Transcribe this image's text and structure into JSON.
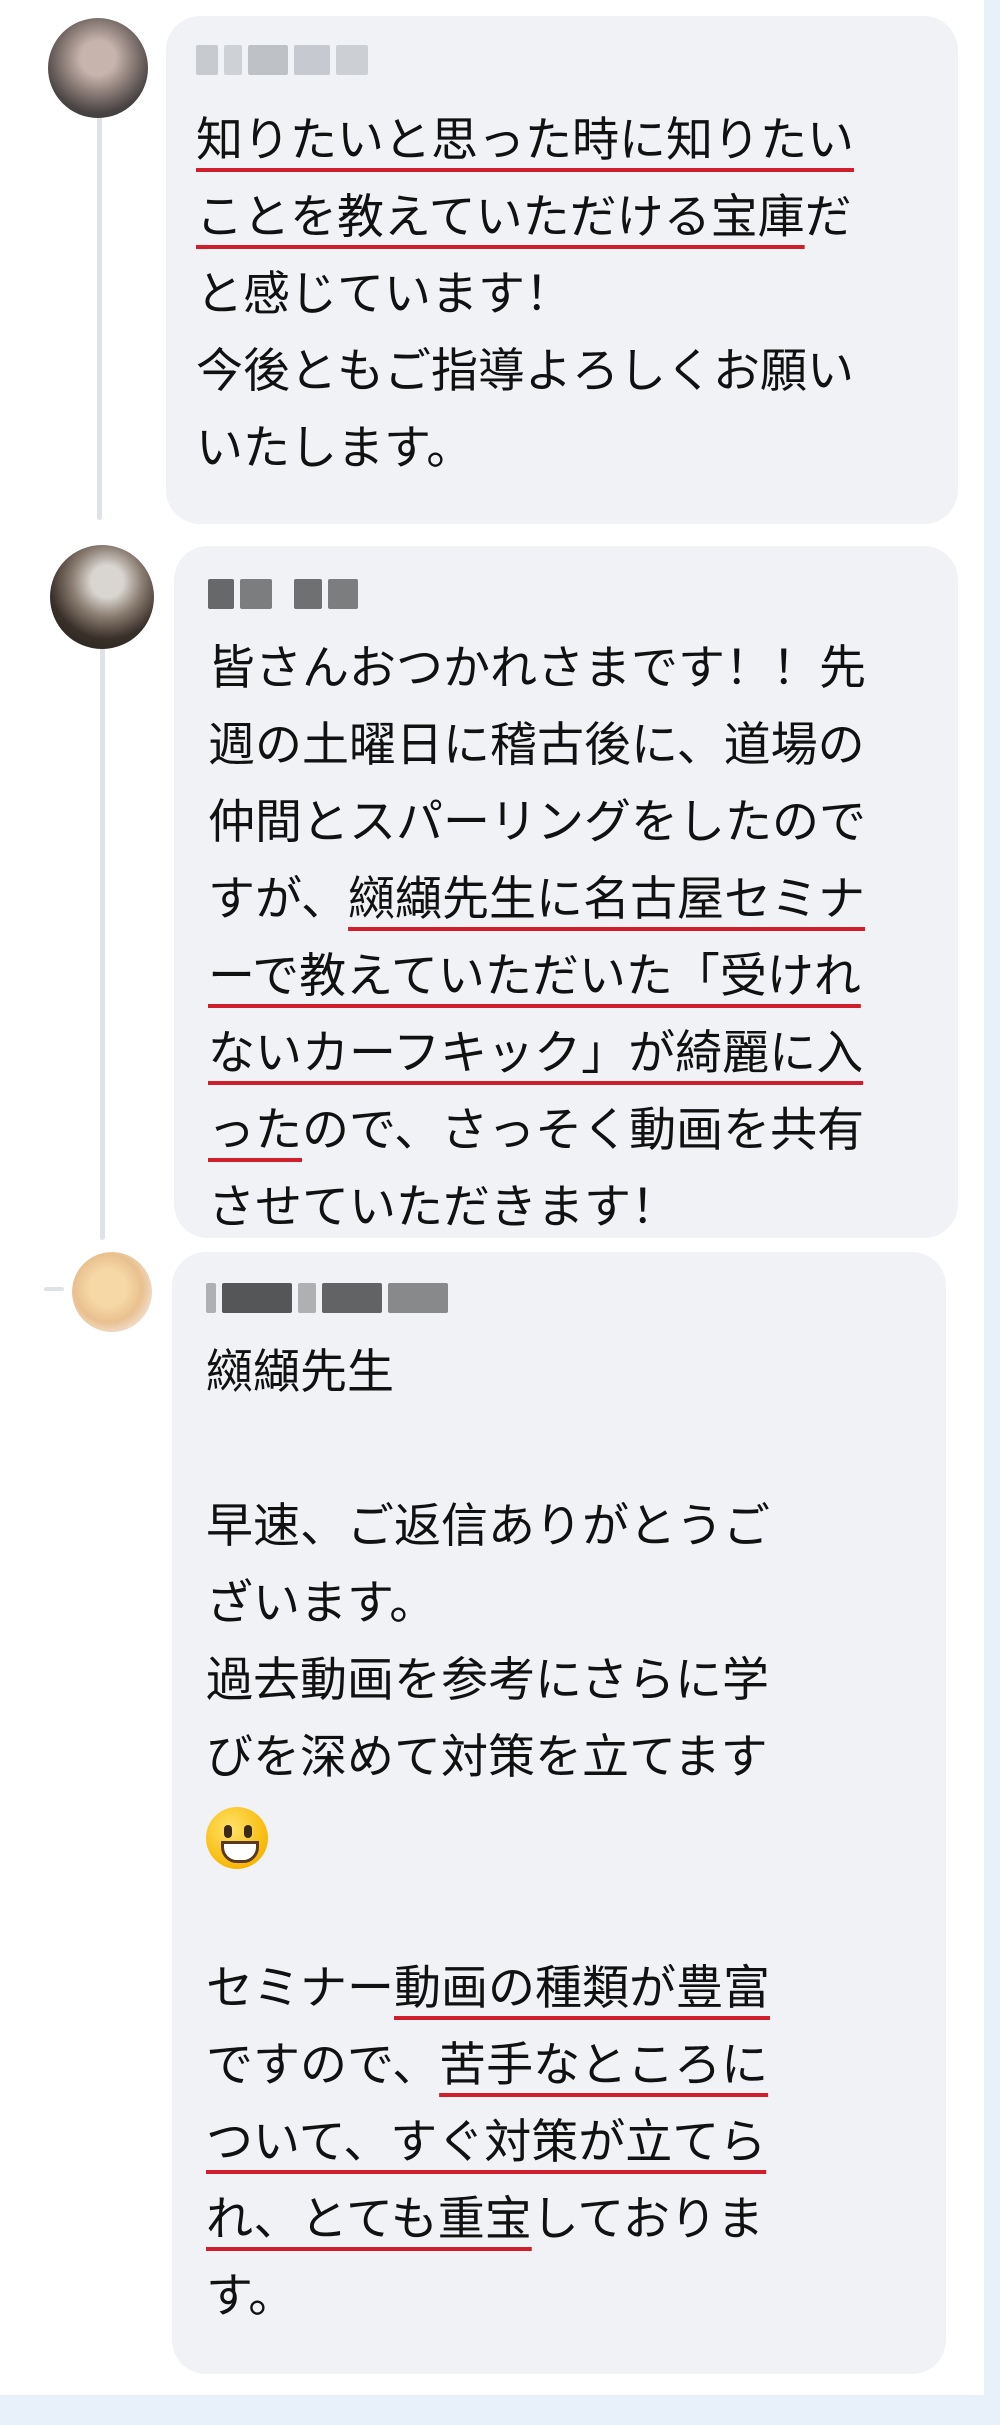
{
  "comments": [
    {
      "lines": [
        [
          {
            "t": "知りたいと思った時に知りたい",
            "u": true
          }
        ],
        [
          {
            "t": "ことを教えていただける宝庫",
            "u": true
          },
          {
            "t": "だ",
            "u": false
          }
        ],
        [
          {
            "t": "と感じています！",
            "u": false
          }
        ],
        [
          {
            "t": "今後ともご指導よろしくお願い",
            "u": false
          }
        ],
        [
          {
            "t": "いたします。",
            "u": false
          }
        ]
      ]
    },
    {
      "lines": [
        [
          {
            "t": "皆さんおつかれさまです！！先",
            "u": false
          }
        ],
        [
          {
            "t": "週の土曜日に稽古後に、道場の",
            "u": false
          }
        ],
        [
          {
            "t": "仲間とスパーリングをしたので",
            "u": false
          }
        ],
        [
          {
            "t": "すが、",
            "u": false
          },
          {
            "t": "纐纈先生に名古屋セミナ",
            "u": true
          }
        ],
        [
          {
            "t": "ーで教えていただいた「受けれ",
            "u": true
          }
        ],
        [
          {
            "t": "ないカーフキック」が綺麗に入",
            "u": true
          }
        ],
        [
          {
            "t": "った",
            "u": true
          },
          {
            "t": "ので、さっそく動画を共有",
            "u": false
          }
        ],
        [
          {
            "t": "させていただきます！",
            "u": false
          }
        ]
      ]
    },
    {
      "lines": [
        [
          {
            "t": "纐纈先生",
            "u": false
          }
        ],
        [],
        [
          {
            "t": "早速、ご返信ありがとうご",
            "u": false
          }
        ],
        [
          {
            "t": "ざいます。",
            "u": false
          }
        ],
        [
          {
            "t": "過去動画を参考にさらに学",
            "u": false
          }
        ],
        [
          {
            "t": "びを深めて対策を立てます",
            "u": false
          }
        ],
        [
          {
            "t": "😀",
            "u": false,
            "emoji": true
          }
        ],
        [],
        [
          {
            "t": "セミナー",
            "u": false
          },
          {
            "t": "動画の種類が豊富",
            "u": true
          }
        ],
        [
          {
            "t": "ですので、",
            "u": false
          },
          {
            "t": "苦手なところに",
            "u": true
          }
        ],
        [
          {
            "t": "ついて、すぐ対策が立てら",
            "u": true
          }
        ],
        [
          {
            "t": "れ、とても重宝",
            "u": true
          },
          {
            "t": "しておりま",
            "u": false
          }
        ],
        [
          {
            "t": "す。",
            "u": false
          }
        ]
      ]
    }
  ],
  "colors": {
    "underline": "#d01f2c",
    "bubble": "#f0f2f5",
    "page": "#e8f0fa"
  }
}
